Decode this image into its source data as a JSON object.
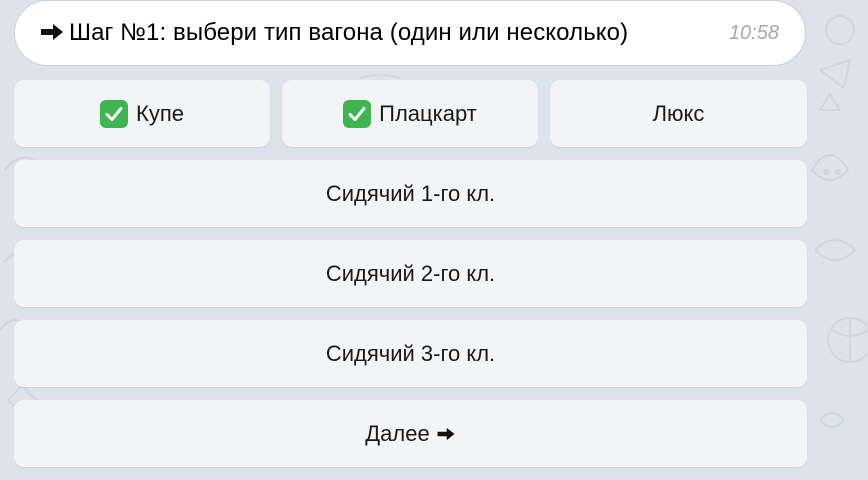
{
  "message": {
    "prefix_icon": "right-arrow-icon",
    "text": "Шаг №1: выбери тип вагона (один или несколько)",
    "time": "10:58"
  },
  "keyboard": {
    "row1": [
      {
        "label": "Купе",
        "checked": true,
        "icon": "check-mark-icon"
      },
      {
        "label": "Плацкарт",
        "checked": true,
        "icon": "check-mark-icon"
      },
      {
        "label": "Люкс",
        "checked": false
      }
    ],
    "seat1": "Сидячий 1-го кл.",
    "seat2": "Сидячий 2-го кл.",
    "seat3": "Сидячий 3-го кл.",
    "next": {
      "label": "Далее",
      "icon": "right-arrow-icon"
    }
  },
  "colors": {
    "background": "#dde3eb",
    "bubble": "#ffffff",
    "button": "#f2f4f6",
    "check": "#3eb550",
    "time": "#a4a9af"
  }
}
